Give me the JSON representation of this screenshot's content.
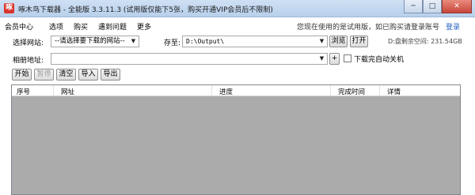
{
  "window": {
    "icon_text": "啄",
    "title": "啄木鸟下载器 - 全能版 3.3.11.3 (试用版仅能下5张，购买开通VIP会员后不限制)",
    "minimize_label": "─",
    "maximize_label": "□",
    "close_label": "✕"
  },
  "menu": {
    "items": [
      "会员中心",
      "选项",
      "购买",
      "遇到问题",
      "更多"
    ],
    "trial_notice": "您现在使用的是试用版，如已购买请登录账号",
    "login_label": "登录"
  },
  "form": {
    "site_label": "选择网站:",
    "site_value": "--请选择要下载的网站--",
    "save_label": "存至:",
    "save_path": "D:\\Output\\",
    "browse_label": "浏览",
    "open_label": "打开",
    "disk_space": "D:盘剩余空间: 231.54GB",
    "album_label": "相册地址:",
    "album_value": "",
    "add_label": "+",
    "shutdown_label": "下载完自动关机",
    "dropdown_arrow": "▼"
  },
  "toolbar": {
    "start_label": "开始",
    "pause_label": "暂停",
    "clear_label": "清空",
    "import_label": "导入",
    "export_label": "导出"
  },
  "table": {
    "columns": [
      "序号",
      "网址",
      "进度",
      "完成时间",
      "详情"
    ]
  }
}
